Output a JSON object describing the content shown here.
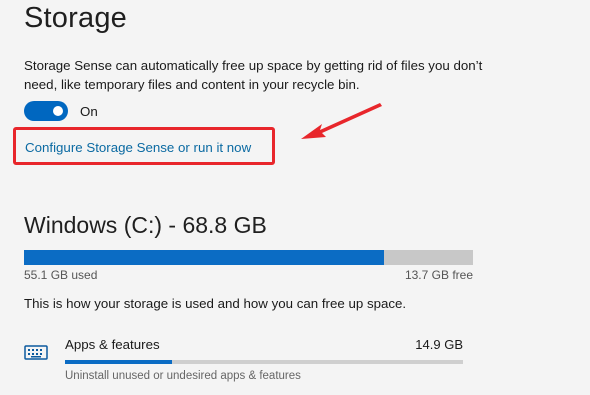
{
  "header": {
    "title": "Storage"
  },
  "storage_sense": {
    "description": "Storage Sense can automatically free up space by getting rid of files you don’t need, like temporary files and content in your recycle bin.",
    "toggle_state": "On",
    "toggle_on": true,
    "configure_link": "Configure Storage Sense or run it now"
  },
  "drive": {
    "title": "Windows (C:) - 68.8 GB",
    "used_label": "55.1 GB used",
    "free_label": "13.7 GB free",
    "used_fraction": 0.8009,
    "info_text": "This is how your storage is used and how you can free up space."
  },
  "categories": [
    {
      "icon": "keyboard-icon",
      "name": "Apps & features",
      "size": "14.9 GB",
      "subtext": "Uninstall unused or undesired apps & features",
      "fraction": 0.27
    }
  ],
  "colors": {
    "accent": "#0b6cc4",
    "toggle": "#0067c0",
    "link": "#0b6aa2",
    "highlight_box": "#e8262b",
    "bar_track": "#c8c8c8",
    "background": "#f4f4f4"
  }
}
